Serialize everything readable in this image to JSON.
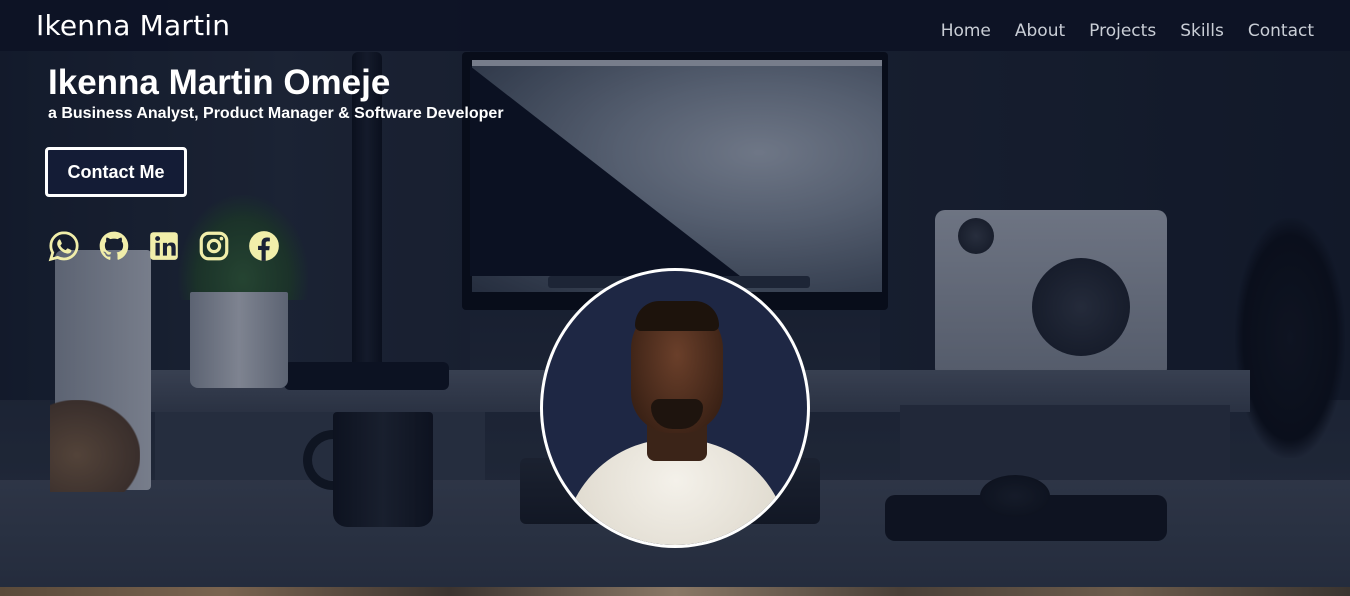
{
  "navbar": {
    "brand": "Ikenna Martin",
    "links": [
      "Home",
      "About",
      "Projects",
      "Skills",
      "Contact"
    ]
  },
  "hero": {
    "title": "Ikenna Martin Omeje",
    "subtitle": "a Business Analyst, Product Manager & Software Developer",
    "cta_label": "Contact Me",
    "socials": [
      {
        "icon": "whatsapp-icon"
      },
      {
        "icon": "github-icon"
      },
      {
        "icon": "linkedin-icon"
      },
      {
        "icon": "instagram-icon"
      },
      {
        "icon": "facebook-icon"
      }
    ],
    "social_icon_color": "#f1eeaa",
    "profile_image": "profile-photo"
  },
  "colors": {
    "navbar_bg": "#0c1224",
    "button_bg": "#141c36",
    "text": "#ffffff",
    "nav_text": "#c9ced6"
  }
}
